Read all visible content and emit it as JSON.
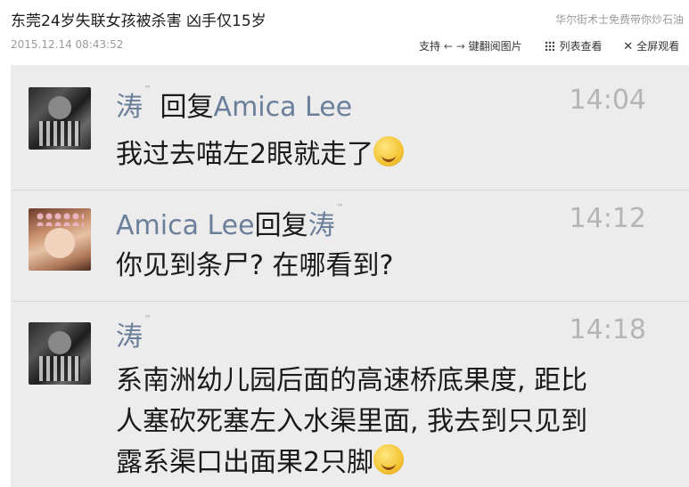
{
  "header": {
    "title": "东莞24岁失联女孩被杀害 凶手仅15岁",
    "ad_text": "华尔街术士免费带你炒石油",
    "date": "2015.12.14 08:43:52",
    "toolbar": {
      "support_label": "支持",
      "arrows": "← →",
      "keyboard_label": "键翻阅图片",
      "list_view_label": "列表查看",
      "fullscreen_label": "全屏观看"
    }
  },
  "messages": [
    {
      "sender": "涛",
      "sup": "™",
      "reply_word": "回复",
      "reply_to": "Amica Lee",
      "time": "14:04",
      "text": "我过去喵左2眼就走了",
      "emoji": "smile-emoji"
    },
    {
      "sender": "Amica Lee",
      "reply_word": "回复",
      "reply_to": "涛",
      "sup": "™",
      "time": "14:12",
      "text": "你见到条尸? 在哪看到?"
    },
    {
      "sender": "涛",
      "sup": "™",
      "time": "14:18",
      "text_lines": [
        "系南洲幼儿园后面的高速桥底果度, 距比",
        "人塞砍死塞左入水渠里面, 我去到只见到",
        "露系渠口出面果2只脚"
      ],
      "emoji": "smile-emoji"
    }
  ],
  "colors": {
    "name": "#6b7f9a",
    "time": "#b5b5b5",
    "bg": "#ececec"
  }
}
